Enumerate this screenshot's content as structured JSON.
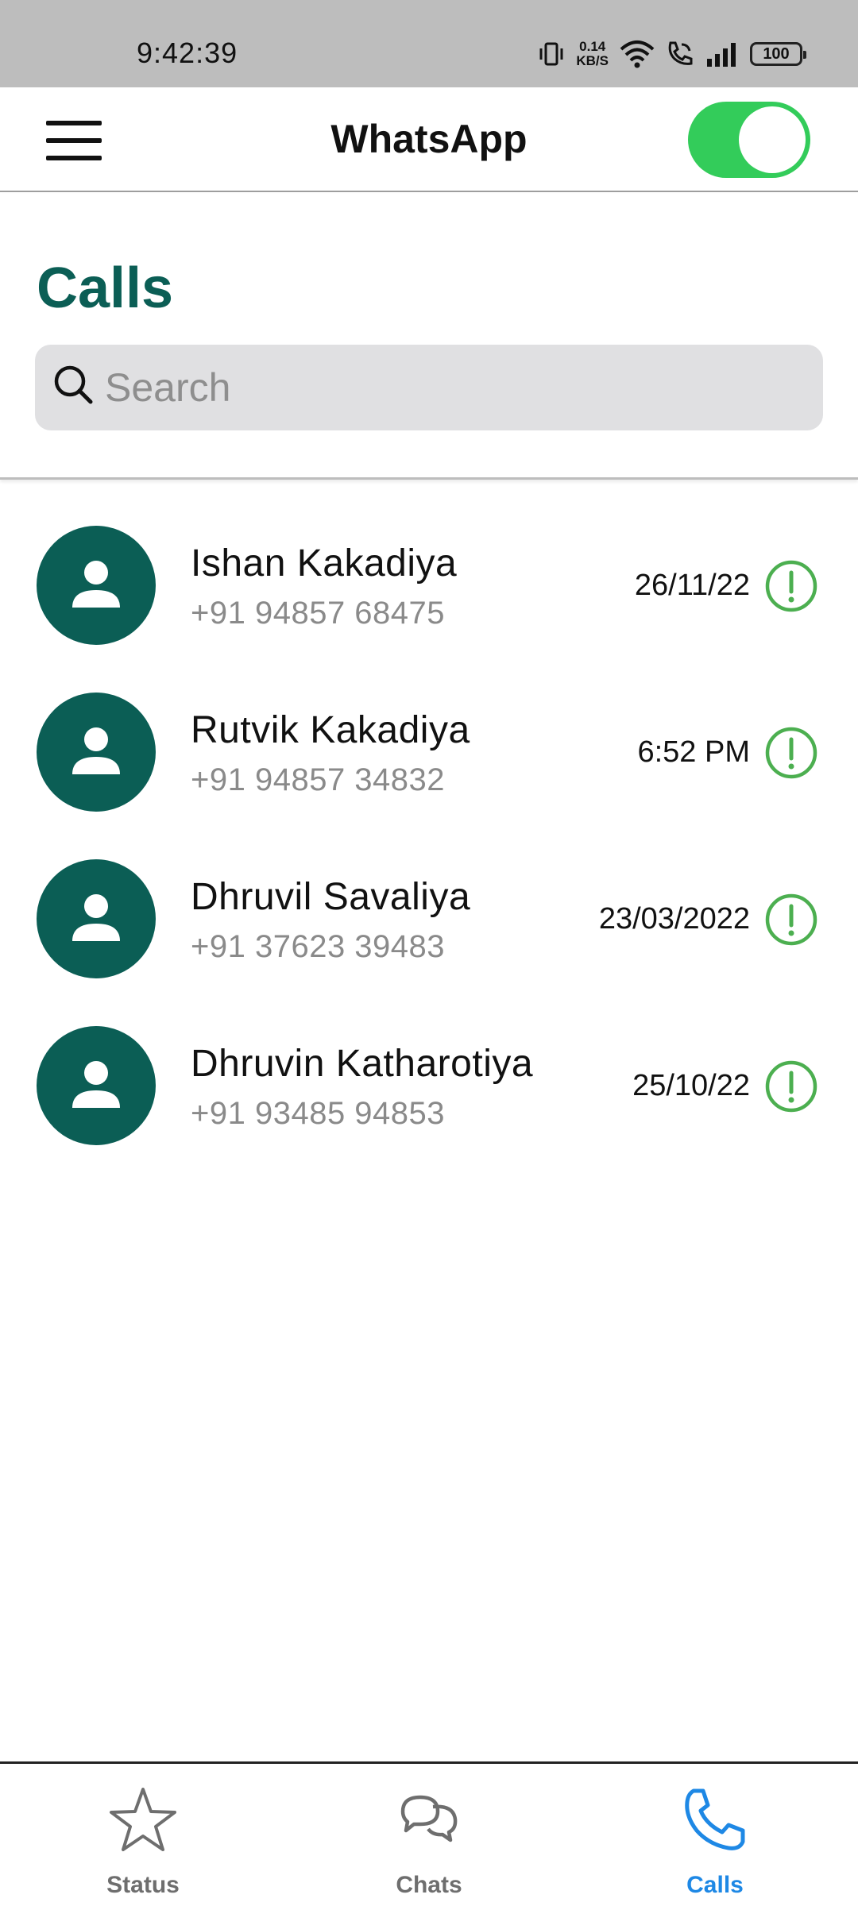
{
  "status_bar": {
    "time": "9:42:39",
    "net_speed_value": "0.14",
    "net_speed_unit": "KB/S",
    "battery": "100"
  },
  "app_bar": {
    "title": "WhatsApp",
    "toggle_on": true,
    "toggle_color": "#33cc5a"
  },
  "page": {
    "title": "Calls",
    "title_color": "#0b5e55"
  },
  "search": {
    "placeholder": "Search",
    "value": ""
  },
  "calls": [
    {
      "name": "Ishan Kakadiya",
      "phone": "+91 94857 68475",
      "time": "26/11/22"
    },
    {
      "name": "Rutvik Kakadiya",
      "phone": "+91 94857 34832",
      "time": "6:52 PM"
    },
    {
      "name": "Dhruvil Savaliya",
      "phone": "+91 37623 39483",
      "time": "23/03/2022"
    },
    {
      "name": "Dhruvin Katharotiya",
      "phone": "+91 93485 94853",
      "time": "25/10/22"
    }
  ],
  "bottom_nav": {
    "items": [
      {
        "label": "Status",
        "icon": "star-icon",
        "active": false
      },
      {
        "label": "Chats",
        "icon": "chat-bubbles-icon",
        "active": false
      },
      {
        "label": "Calls",
        "icon": "phone-icon",
        "active": true
      }
    ],
    "active_color": "#1e88e5"
  }
}
